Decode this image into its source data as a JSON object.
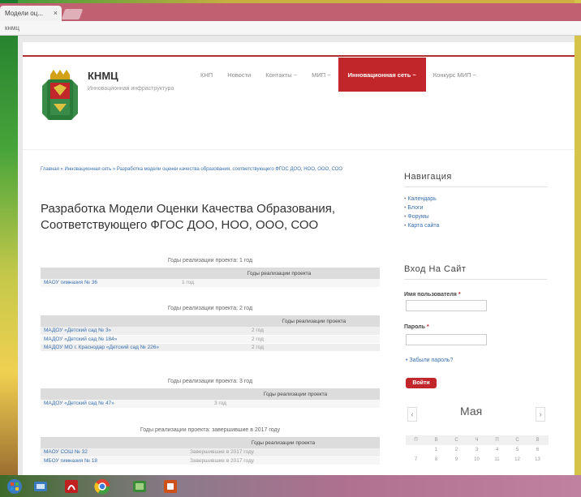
{
  "browser": {
    "tab_title": "Модели оц...",
    "tab_close": "×",
    "address": "кнмц"
  },
  "site": {
    "title": "КНМЦ",
    "tagline": "Инновационная инфраструктура"
  },
  "nav": {
    "items": [
      {
        "label": "КНП"
      },
      {
        "label": "Новости"
      },
      {
        "label": "Контакты ~"
      },
      {
        "label": "МИП ~"
      },
      {
        "label": "Инновационная сеть ~"
      },
      {
        "label": "Конкурс МИП ~"
      }
    ]
  },
  "content": {
    "breadcrumb": "Главная » Инновационная сеть » Разработка модели оценки качества образования, соответствующего ФГОС ДОО, НОО, ООО, СОО",
    "title": "Разработка Модели Оценки Качества Образования, Соответствующего ФГОС ДОО, НОО, ООО, СОО",
    "column_header": "Годы реализации проекта",
    "tables": [
      {
        "caption": "Годы реализации проекта: 1 год",
        "rows": [
          {
            "org": "МАОУ гимназия № 36",
            "years": "1 год"
          }
        ]
      },
      {
        "caption": "Годы реализации проекта: 2 год",
        "rows": [
          {
            "org": "МАДОУ «Детский сад № 3»",
            "years": "2 год"
          },
          {
            "org": "МАДОУ «Детский сад № 184»",
            "years": "2 год"
          },
          {
            "org": "МАДОУ МО г. Краснодар «Детский сад № 226»",
            "years": "2 год"
          }
        ]
      },
      {
        "caption": "Годы реализации проекта: 3 год",
        "rows": [
          {
            "org": "МАДОУ «Детский сад № 47»",
            "years": "3 год"
          }
        ]
      },
      {
        "caption": "Годы реализации проекта: завершившие в 2017 году",
        "rows": [
          {
            "org": "МАОУ СОШ № 32",
            "years": "Завершившие в 2017 году"
          },
          {
            "org": "МБОУ гимназия № 18",
            "years": "Завершившие в 2017 году"
          }
        ]
      }
    ]
  },
  "sidebar": {
    "nav_title": "Навигация",
    "links": [
      "Календарь",
      "Блоги",
      "Форумы",
      "Карта сайта"
    ],
    "login_title": "Вход На Сайт",
    "username_label": "Имя пользователя",
    "password_label": "Пароль",
    "required_mark": "*",
    "forgot_link": "Забыли пароль?",
    "login_button": "Войти",
    "calendar": {
      "month": "Мая",
      "prev": "‹",
      "next": "›",
      "weekdays": [
        "П",
        "В",
        "С",
        "Ч",
        "П",
        "С",
        "В"
      ],
      "weeks": [
        [
          "",
          "1",
          "2",
          "3",
          "4",
          "5",
          "6"
        ],
        [
          "7",
          "8",
          "9",
          "10",
          "11",
          "12",
          "13"
        ]
      ]
    }
  },
  "colors": {
    "accent": "#c0262a",
    "link": "#3a70b0"
  }
}
